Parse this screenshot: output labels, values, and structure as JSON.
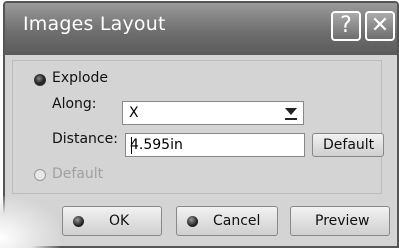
{
  "window": {
    "title": "Images Layout",
    "help_glyph": "?",
    "close_glyph": "✕"
  },
  "explode": {
    "label": "Explode",
    "selected": true
  },
  "along": {
    "label": "Along:",
    "value": "X"
  },
  "distance": {
    "label": "Distance:",
    "value": "4.595in",
    "default_button": "Default"
  },
  "default_option": {
    "label": "Default",
    "selected": false
  },
  "buttons": {
    "ok": "OK",
    "cancel": "Cancel",
    "preview": "Preview"
  }
}
